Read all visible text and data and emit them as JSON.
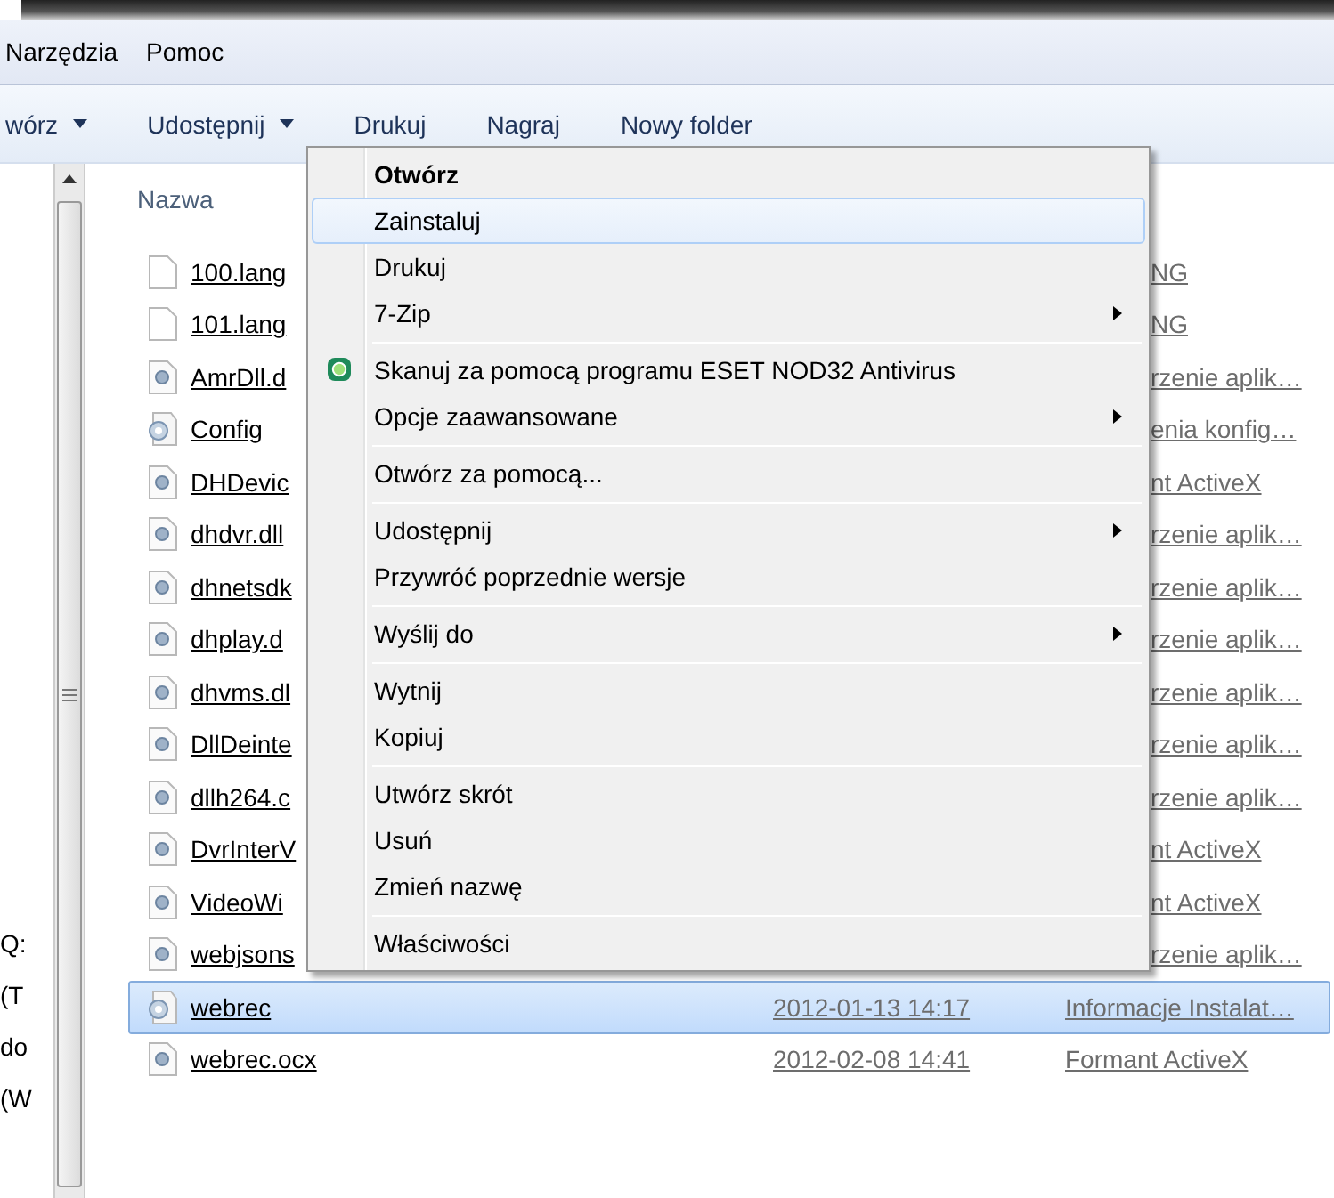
{
  "menu_bar": {
    "items": [
      "Narzędzia",
      "Pomoc"
    ]
  },
  "toolbar": {
    "items": [
      {
        "label": "wórz",
        "dropdown": true
      },
      {
        "label": "Udostępnij",
        "dropdown": true
      },
      {
        "label": "Drukuj",
        "dropdown": false
      },
      {
        "label": "Nagraj",
        "dropdown": false
      },
      {
        "label": "Nowy folder",
        "dropdown": false
      }
    ]
  },
  "navigation": {
    "items": [
      "Q:",
      "(T",
      "do",
      "(W"
    ]
  },
  "file_list": {
    "columns": [
      "Nazwa"
    ],
    "rows": [
      {
        "name": "100.lang",
        "kind": "blank",
        "type": "NG",
        "selected": false
      },
      {
        "name": "101.lang",
        "kind": "blank",
        "type": "NG",
        "selected": false
      },
      {
        "name": "AmrDll.d",
        "kind": "dll",
        "type": "rzenie aplik…",
        "selected": false
      },
      {
        "name": "Config",
        "kind": "config",
        "type": "enia konfig…",
        "selected": false
      },
      {
        "name": "DHDevic",
        "kind": "dll",
        "type": "nt ActiveX",
        "selected": false
      },
      {
        "name": "dhdvr.dll",
        "kind": "dll",
        "type": "rzenie aplik…",
        "selected": false
      },
      {
        "name": "dhnetsdk",
        "kind": "dll",
        "type": "rzenie aplik…",
        "selected": false
      },
      {
        "name": "dhplay.d",
        "kind": "dll",
        "type": "rzenie aplik…",
        "selected": false
      },
      {
        "name": "dhvms.dl",
        "kind": "dll",
        "type": "rzenie aplik…",
        "selected": false
      },
      {
        "name": "DllDeinte",
        "kind": "dll",
        "type": "rzenie aplik…",
        "selected": false
      },
      {
        "name": "dllh264.c",
        "kind": "dll",
        "type": "rzenie aplik…",
        "selected": false
      },
      {
        "name": "DvrInterV",
        "kind": "dll",
        "type": "nt ActiveX",
        "selected": false
      },
      {
        "name": "VideoWi",
        "kind": "dll",
        "type": "nt ActiveX",
        "selected": false
      },
      {
        "name": "webjsons",
        "kind": "dll",
        "type": "rzenie aplik…",
        "selected": false
      },
      {
        "name": "webrec",
        "kind": "config",
        "date": "2012-01-13 14:17",
        "type": "Informacje Instalat…",
        "selected": true
      },
      {
        "name": "webrec.ocx",
        "kind": "dll",
        "date": "2012-02-08 14:41",
        "type": "Formant ActiveX",
        "selected": false
      }
    ]
  },
  "context_menu": {
    "groups": [
      {
        "items": [
          {
            "kind": "plain",
            "label": "Otwórz",
            "default": true,
            "selected": false,
            "submenu": false
          },
          {
            "kind": "plain",
            "label": "Zainstaluj",
            "default": false,
            "selected": true,
            "submenu": false
          },
          {
            "kind": "plain",
            "label": "Drukuj",
            "default": false,
            "selected": false,
            "submenu": false
          },
          {
            "kind": "plain",
            "label": "7-Zip",
            "default": false,
            "selected": false,
            "submenu": true
          }
        ]
      },
      {
        "items": [
          {
            "kind": "scan",
            "label": "Skanuj za pomocą programu ESET NOD32 Antivirus",
            "default": false,
            "selected": false,
            "submenu": false
          },
          {
            "kind": "plain",
            "label": "Opcje zaawansowane",
            "default": false,
            "selected": false,
            "submenu": true
          }
        ]
      },
      {
        "items": [
          {
            "kind": "plain",
            "label": "Otwórz za pomocą...",
            "default": false,
            "selected": false,
            "submenu": false
          }
        ]
      },
      {
        "items": [
          {
            "kind": "plain",
            "label": "Udostępnij",
            "default": false,
            "selected": false,
            "submenu": true
          },
          {
            "kind": "plain",
            "label": "Przywróć poprzednie wersje",
            "default": false,
            "selected": false,
            "submenu": false
          }
        ]
      },
      {
        "items": [
          {
            "kind": "plain",
            "label": "Wyślij do",
            "default": false,
            "selected": false,
            "submenu": true
          }
        ]
      },
      {
        "items": [
          {
            "kind": "plain",
            "label": "Wytnij",
            "default": false,
            "selected": false,
            "submenu": false
          },
          {
            "kind": "plain",
            "label": "Kopiuj",
            "default": false,
            "selected": false,
            "submenu": false
          }
        ]
      },
      {
        "items": [
          {
            "kind": "plain",
            "label": "Utwórz skrót",
            "default": false,
            "selected": false,
            "submenu": false
          },
          {
            "kind": "plain",
            "label": "Usuń",
            "default": false,
            "selected": false,
            "submenu": false
          },
          {
            "kind": "plain",
            "label": "Zmień nazwę",
            "default": false,
            "selected": false,
            "submenu": false
          }
        ]
      },
      {
        "items": [
          {
            "kind": "plain",
            "label": "Właściwości",
            "default": false,
            "selected": false,
            "submenu": false
          }
        ]
      }
    ]
  }
}
